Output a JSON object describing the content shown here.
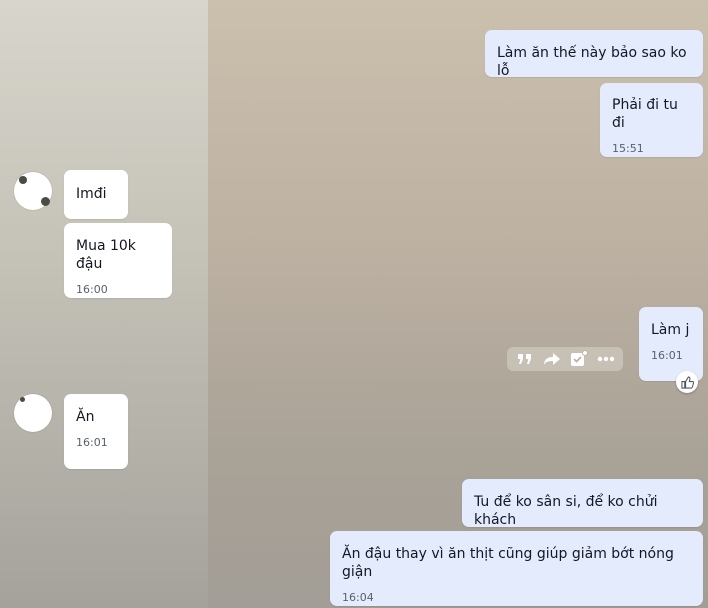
{
  "messages": [
    {
      "text": "Làm ăn thế này bảo sao ko lỗ",
      "time": ""
    },
    {
      "text": "Phải đi tu đi",
      "time": "15:51"
    },
    {
      "text": "Imđi",
      "time": ""
    },
    {
      "text": "Mua 10k đậu",
      "time": "16:00"
    },
    {
      "text": "Làm j",
      "time": "16:01"
    },
    {
      "text": "Ăn",
      "time": "16:01"
    },
    {
      "text": "Tu để ko sân si, để ko chửi khách",
      "time": ""
    },
    {
      "text": "Ăn đậu thay vì ăn thịt cũng giúp giảm bớt nóng giận",
      "time": "16:04"
    }
  ],
  "message_toolbar": {
    "icons": [
      "quote-icon",
      "forward-icon",
      "add-task-icon",
      "more-icon"
    ]
  },
  "reaction_icon": "thumbs-up-icon",
  "colors": {
    "incoming_bubble": "#ffffff",
    "outgoing_bubble": "#e3ebfd",
    "text": "#141823",
    "time": "#59606e"
  }
}
